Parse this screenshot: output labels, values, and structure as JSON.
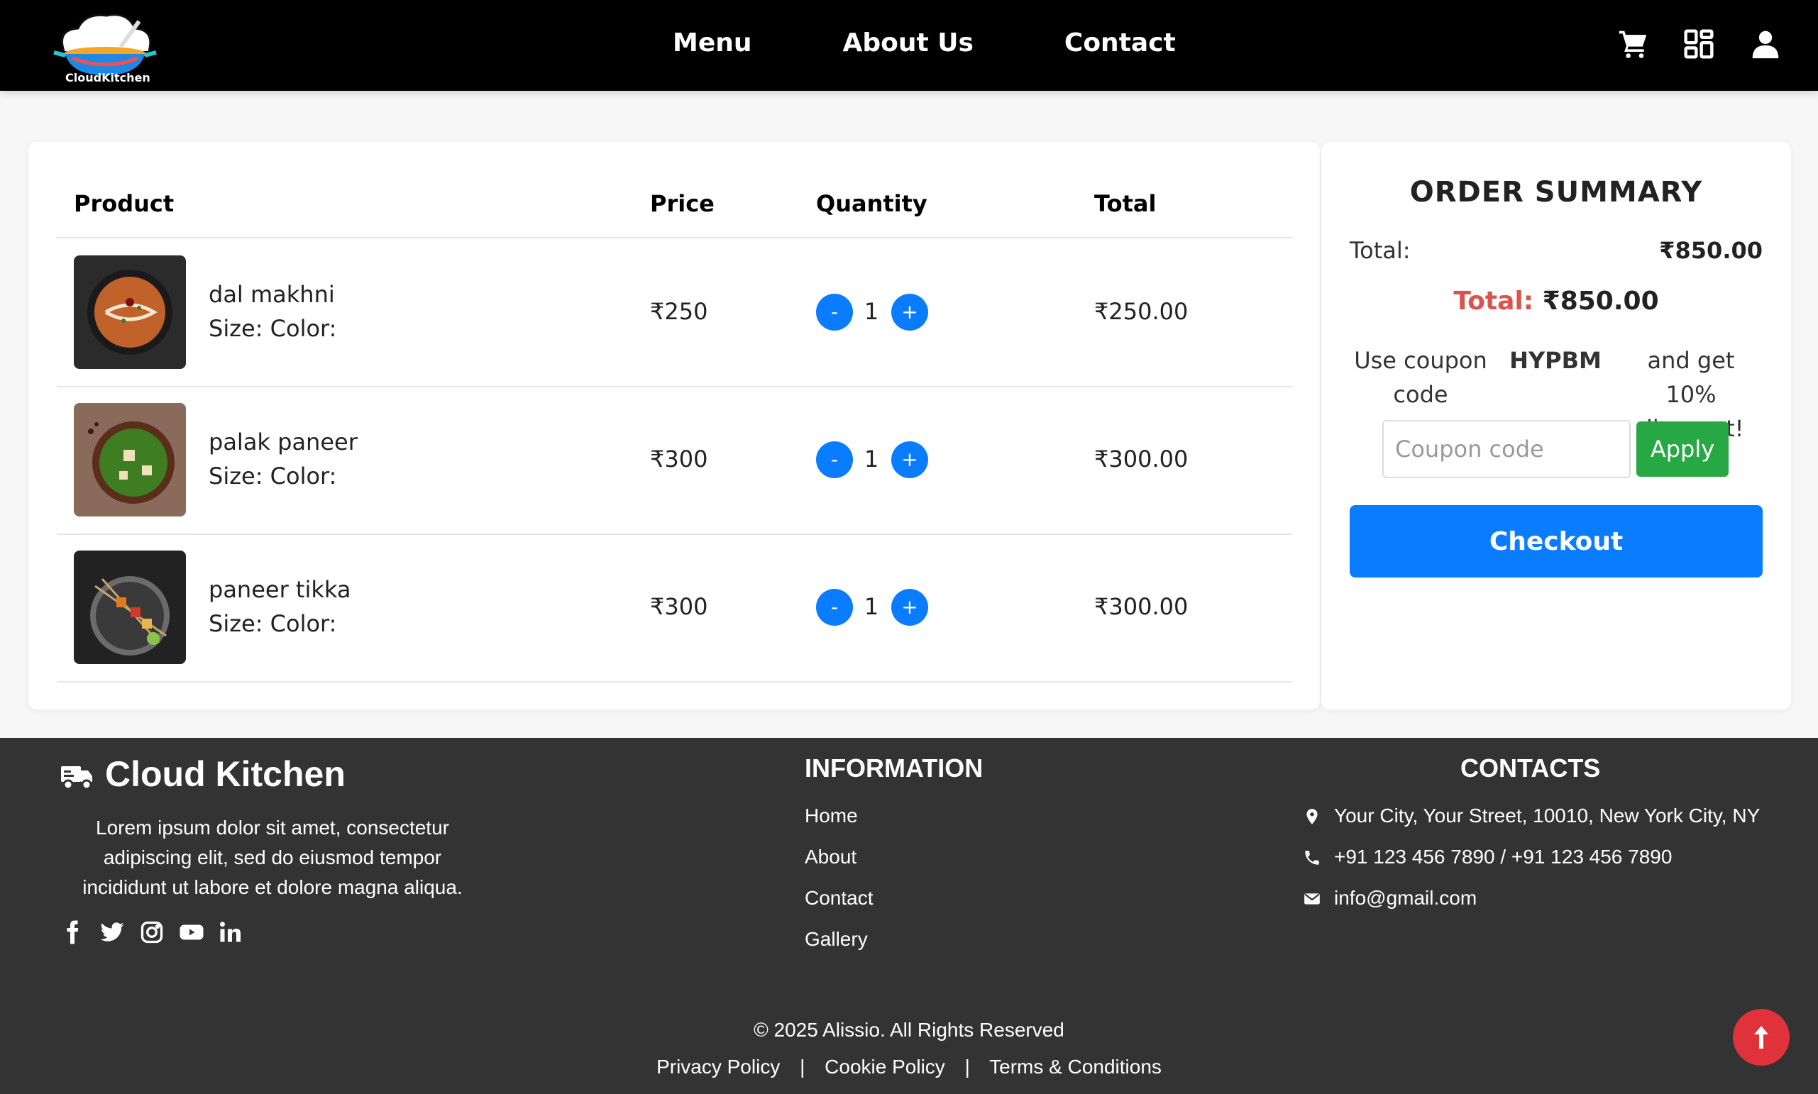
{
  "nav": {
    "logo_text": "CloudKitchen",
    "links": [
      "Menu",
      "About Us",
      "Contact"
    ],
    "icons": [
      "cart-icon",
      "grid-icon",
      "user-icon"
    ]
  },
  "cart": {
    "headers": {
      "product": "Product",
      "price": "Price",
      "quantity": "Quantity",
      "total": "Total"
    },
    "items": [
      {
        "name": "dal makhni",
        "size_color": "Size: Color:",
        "price": "₹250",
        "qty": "1",
        "total": "₹250.00",
        "minus": "-",
        "plus": "+"
      },
      {
        "name": "palak paneer",
        "size_color": "Size: Color:",
        "price": "₹300",
        "qty": "1",
        "total": "₹300.00",
        "minus": "-",
        "plus": "+"
      },
      {
        "name": "paneer tikka",
        "size_color": "Size: Color:",
        "price": "₹300",
        "qty": "1",
        "total": "₹300.00",
        "minus": "-",
        "plus": "+"
      }
    ]
  },
  "summary": {
    "title": "ORDER SUMMARY",
    "total_label": "Total:",
    "total_value": "₹850.00",
    "grand_label": "Total:",
    "grand_value": "₹850.00",
    "coupon_pre": "Use coupon code",
    "coupon_code": "HYPBM",
    "coupon_post": "and get 10% discount!",
    "coupon_placeholder": "Coupon code",
    "apply_label": "Apply",
    "checkout_label": "Checkout"
  },
  "footer": {
    "brand": "Cloud Kitchen",
    "description": "Lorem ipsum dolor sit amet, consectetur adipiscing elit, sed do eiusmod tempor incididunt ut labore et dolore magna aliqua.",
    "socials": [
      "facebook-icon",
      "twitter-icon",
      "instagram-icon",
      "youtube-icon",
      "linkedin-icon"
    ],
    "info_title": "INFORMATION",
    "info_links": [
      "Home",
      "About",
      "Contact",
      "Gallery"
    ],
    "contacts_title": "CONTACTS",
    "address": "Your City, Your Street, 10010, New York City, NY",
    "phone": "+91 123 456 7890 / +91 123 456 7890",
    "email": "info@gmail.com",
    "copyright": "© 2025 Alissio. All Rights Reserved",
    "policies": [
      "Privacy Policy",
      "Cookie Policy",
      "Terms & Conditions"
    ],
    "separator": "|"
  },
  "colors": {
    "primary_blue": "#0a7cff",
    "apply_green": "#28a745",
    "total_red": "#d9534f",
    "to_top_red": "#e0323a",
    "footer_bg": "#333333",
    "navbar_bg": "#000000"
  }
}
